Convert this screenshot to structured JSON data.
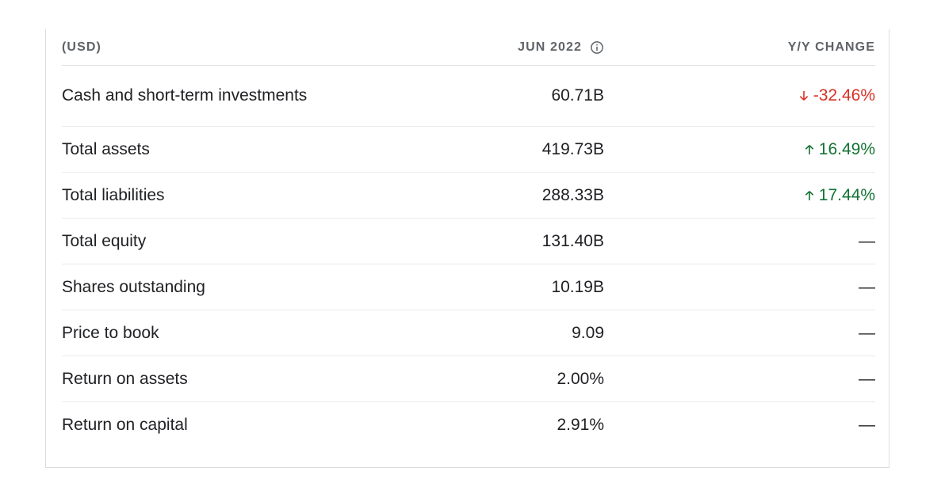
{
  "header": {
    "currency": "(USD)",
    "period": "JUN 2022",
    "change": "Y/Y CHANGE"
  },
  "rows": [
    {
      "label": "Cash and short-term investments",
      "value": "60.71B",
      "change": "-32.46%",
      "direction": "down"
    },
    {
      "label": "Total assets",
      "value": "419.73B",
      "change": "16.49%",
      "direction": "up"
    },
    {
      "label": "Total liabilities",
      "value": "288.33B",
      "change": "17.44%",
      "direction": "up"
    },
    {
      "label": "Total equity",
      "value": "131.40B",
      "change": "—",
      "direction": "none"
    },
    {
      "label": "Shares outstanding",
      "value": "10.19B",
      "change": "—",
      "direction": "none"
    },
    {
      "label": "Price to book",
      "value": "9.09",
      "change": "—",
      "direction": "none"
    },
    {
      "label": "Return on assets",
      "value": "2.00%",
      "change": "—",
      "direction": "none"
    },
    {
      "label": "Return on capital",
      "value": "2.91%",
      "change": "—",
      "direction": "none"
    }
  ],
  "colors": {
    "negative": "#d93025",
    "positive": "#137333"
  },
  "icons": {
    "info": "info-circle-icon",
    "up": "arrow-up-icon",
    "down": "arrow-down-icon"
  }
}
